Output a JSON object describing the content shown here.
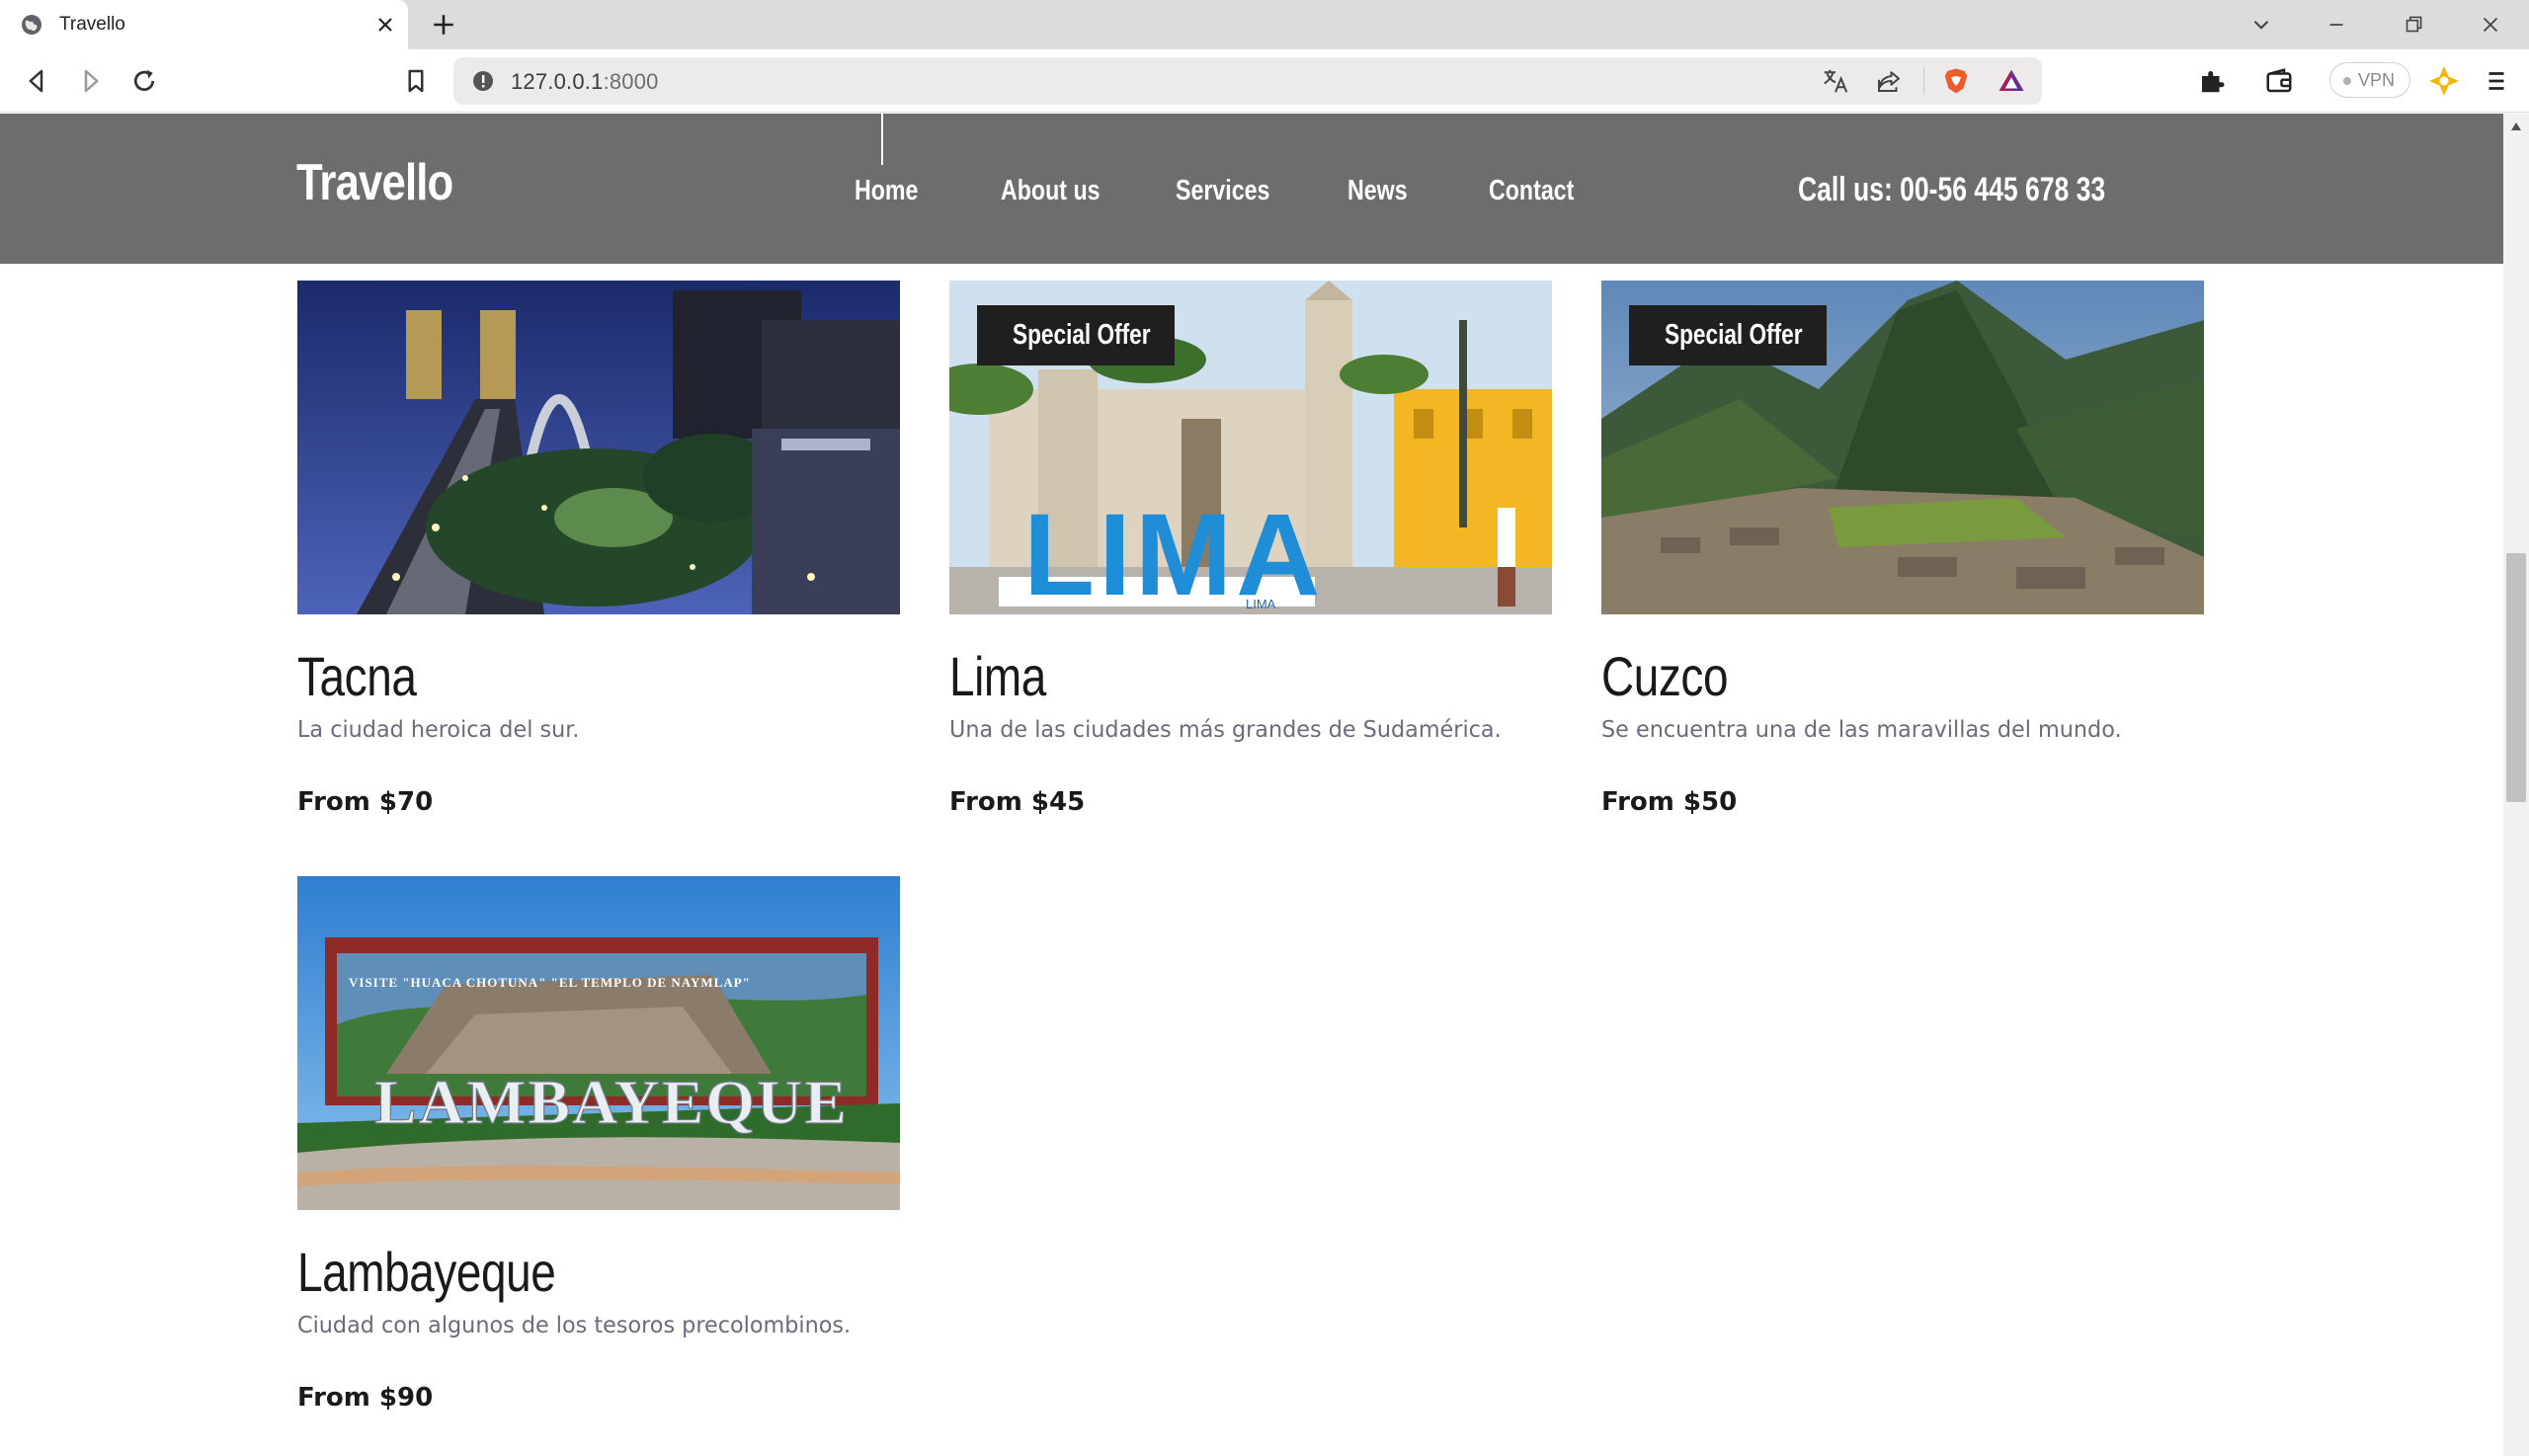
{
  "browser": {
    "tab_title": "Travello",
    "url_host": "127.0.0.1",
    "url_port": ":8000",
    "vpn_label": "VPN"
  },
  "site": {
    "logo": "Travello",
    "nav": [
      "Home",
      "About us",
      "Services",
      "News",
      "Contact"
    ],
    "call_us": "Call us: 00-56 445 678 33"
  },
  "destinations": [
    {
      "name": "Tacna",
      "description": "La ciudad heroica del sur.",
      "price": "From $70",
      "badge": ""
    },
    {
      "name": "Lima",
      "description": "Una de las ciudades más grandes de Sudamérica.",
      "price": "From $45",
      "badge": "Special Offer"
    },
    {
      "name": "Cuzco",
      "description": "Se encuentra una de las maravillas del mundo.",
      "price": "From $50",
      "badge": "Special Offer"
    },
    {
      "name": "Lambayeque",
      "description": "Ciudad con algunos de los tesoros precolombinos.",
      "price": "From $90",
      "badge": ""
    }
  ],
  "photo_text": {
    "lima_sign": "LIMA",
    "lima_small": "LIMA",
    "lambayeque_sign": "LAMBAYEQUE",
    "lambayeque_banner": "VISITE \"HUACA CHOTUNA\" \"EL TEMPLO DE NAYMLAP\""
  },
  "colors": {
    "header_bg": "#6d6d6d",
    "badge_bg": "#1f1f1f",
    "desc_text": "#6b6b7a"
  }
}
